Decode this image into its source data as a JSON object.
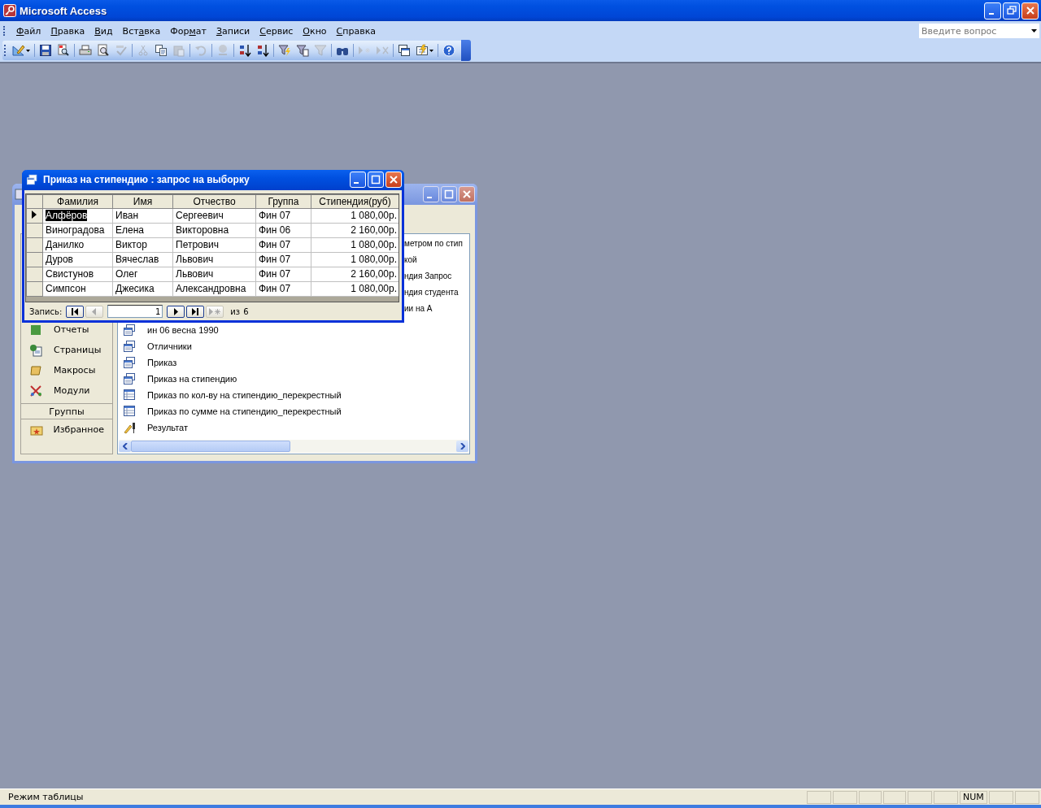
{
  "app": {
    "title": "Microsoft Access"
  },
  "menu": [
    {
      "key": "Ф",
      "after": "айл"
    },
    {
      "key": "П",
      "after": "равка"
    },
    {
      "key": "В",
      "after": "ид"
    },
    {
      "before": "Вст",
      "key": "а",
      "after": "вка"
    },
    {
      "before": "Фор",
      "key": "м",
      "after": "ат"
    },
    {
      "key": "З",
      "after": "аписи"
    },
    {
      "key": "С",
      "after": "ервис"
    },
    {
      "key": "О",
      "after": "кно"
    },
    {
      "key": "С",
      "after": "правка"
    }
  ],
  "help_box": {
    "placeholder": "Введите вопрос"
  },
  "toolbar": [
    [
      {
        "kind": "design",
        "disabled": false
      }
    ],
    [
      {
        "kind": "save",
        "disabled": false
      },
      {
        "kind": "search",
        "disabled": false
      }
    ],
    [
      {
        "kind": "print",
        "disabled": false
      },
      {
        "kind": "preview",
        "disabled": false
      },
      {
        "kind": "spelling",
        "disabled": true
      }
    ],
    [
      {
        "kind": "cut",
        "disabled": true
      },
      {
        "kind": "copy",
        "disabled": false
      },
      {
        "kind": "paste",
        "disabled": true
      }
    ],
    [
      {
        "kind": "undo",
        "disabled": true
      }
    ],
    [
      {
        "kind": "link",
        "disabled": true
      }
    ],
    [
      {
        "kind": "sortup",
        "disabled": false
      },
      {
        "kind": "sortdown",
        "disabled": false
      }
    ],
    [
      {
        "kind": "filtersel",
        "disabled": false
      },
      {
        "kind": "filterform",
        "disabled": false
      },
      {
        "kind": "filter",
        "disabled": true
      }
    ],
    [
      {
        "kind": "find",
        "disabled": false
      }
    ],
    [
      {
        "kind": "newrec",
        "disabled": true
      },
      {
        "kind": "delrec",
        "disabled": true
      }
    ],
    [
      {
        "kind": "dbwin",
        "disabled": false
      },
      {
        "kind": "newobj",
        "disabled": false
      }
    ],
    [
      {
        "kind": "help",
        "disabled": false
      }
    ]
  ],
  "database_window": {
    "sidebar": [
      {
        "label": "Отчеты",
        "kind": "report"
      },
      {
        "label": "Страницы",
        "kind": "page"
      },
      {
        "label": "Макросы",
        "kind": "macro"
      },
      {
        "label": "Модули",
        "kind": "module"
      }
    ],
    "groups_header": "Группы",
    "groups": [
      {
        "label": "Избранное",
        "kind": "favorites"
      }
    ],
    "hidden_objects_tails": [
      "метром по стип",
      "кой",
      "ндия Запрос",
      "ндия студента",
      "ии на А"
    ],
    "objects": [
      {
        "name": "ин 06 весна 1990",
        "kind": "query"
      },
      {
        "name": "Отличники",
        "kind": "query"
      },
      {
        "name": "Приказ",
        "kind": "query"
      },
      {
        "name": "Приказ на стипендию",
        "kind": "query"
      },
      {
        "name": "Приказ по кол-ву на стипендию_перекрестный",
        "kind": "crosstab"
      },
      {
        "name": "Приказ по сумме на стипендию_перекрестный",
        "kind": "crosstab"
      },
      {
        "name": "Результат",
        "kind": "update"
      }
    ]
  },
  "query_window": {
    "title": "Приказ на стипендию : запрос на выборку",
    "columns": [
      "Фамилия",
      "Имя",
      "Отчество",
      "Группа",
      "Стипендия(руб)"
    ],
    "rows": [
      {
        "selected": true,
        "cells": [
          "Алфёров",
          "Иван",
          "Сергеевич",
          "Фин 07",
          "1 080,00р."
        ]
      },
      {
        "selected": false,
        "cells": [
          "Виноградова",
          "Елена",
          "Викторовна",
          "Фин 06",
          "2 160,00р."
        ]
      },
      {
        "selected": false,
        "cells": [
          "Данилко",
          "Виктор",
          "Петрович",
          "Фин 07",
          "1 080,00р."
        ]
      },
      {
        "selected": false,
        "cells": [
          "Дуров",
          "Вячеслав",
          "Львович",
          "Фин 07",
          "1 080,00р."
        ]
      },
      {
        "selected": false,
        "cells": [
          "Свистунов",
          "Олег",
          "Львович",
          "Фин 07",
          "2 160,00р."
        ]
      },
      {
        "selected": false,
        "cells": [
          "Симпсон",
          "Джесика",
          "Александровна",
          "Фин 07",
          "1 080,00р."
        ]
      }
    ],
    "nav": {
      "label": "Запись:",
      "record": "1",
      "of": "из",
      "total": "6",
      "first_disabled": false,
      "prev_disabled": true,
      "next_disabled": false,
      "last_disabled": false,
      "new_disabled": true
    }
  },
  "status_bar": {
    "text": "Режим таблицы",
    "indicator": "NUM"
  }
}
